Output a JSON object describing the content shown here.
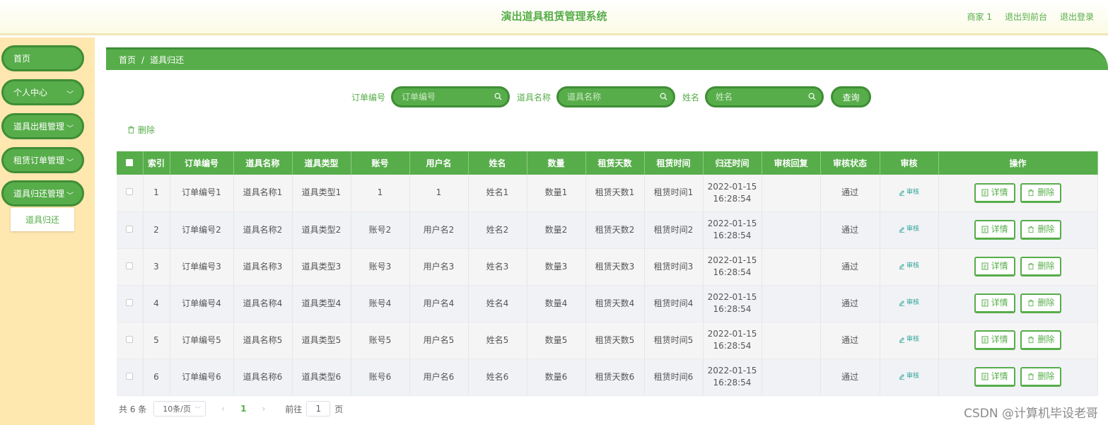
{
  "header": {
    "title": "演出道具租赁管理系统",
    "user": "商家 1",
    "front_link": "退出到前台",
    "logout_link": "退出登录"
  },
  "sidebar": {
    "items": [
      {
        "label": "首页",
        "has_children": false
      },
      {
        "label": "个人中心",
        "has_children": true
      },
      {
        "label": "道具出租管理",
        "has_children": true
      },
      {
        "label": "租赁订单管理",
        "has_children": true
      },
      {
        "label": "道具归还管理",
        "has_children": true
      }
    ],
    "active_sub": "道具归还"
  },
  "breadcrumb": {
    "home": "首页",
    "separator": "/",
    "current": "道具归还"
  },
  "search": {
    "order_label": "订单编号",
    "order_placeholder": "订单编号",
    "prop_label": "道具名称",
    "prop_placeholder": "道具名称",
    "name_label": "姓名",
    "name_placeholder": "姓名",
    "query_button": "查询"
  },
  "toolbar": {
    "delete_label": "删除"
  },
  "table": {
    "columns": [
      "索引",
      "订单编号",
      "道具名称",
      "道具类型",
      "账号",
      "用户名",
      "姓名",
      "数量",
      "租赁天数",
      "租赁时间",
      "归还时间",
      "审核回复",
      "审核状态",
      "审核",
      "操作"
    ],
    "review_label": "审核",
    "detail_label": "详情",
    "delete_label": "删除",
    "rows": [
      {
        "index": "1",
        "order_no": "订单编号1",
        "prop_name": "道具名称1",
        "prop_type": "道具类型1",
        "account": "1",
        "username": "1",
        "name": "姓名1",
        "quantity": "数量1",
        "days": "租赁天数1",
        "rent_time": "租赁时间1",
        "return_date": "2022-01-15",
        "return_clock": "16:28:54",
        "reply": "",
        "status": "通过"
      },
      {
        "index": "2",
        "order_no": "订单编号2",
        "prop_name": "道具名称2",
        "prop_type": "道具类型2",
        "account": "账号2",
        "username": "用户名2",
        "name": "姓名2",
        "quantity": "数量2",
        "days": "租赁天数2",
        "rent_time": "租赁时间2",
        "return_date": "2022-01-15",
        "return_clock": "16:28:54",
        "reply": "",
        "status": "通过"
      },
      {
        "index": "3",
        "order_no": "订单编号3",
        "prop_name": "道具名称3",
        "prop_type": "道具类型3",
        "account": "账号3",
        "username": "用户名3",
        "name": "姓名3",
        "quantity": "数量3",
        "days": "租赁天数3",
        "rent_time": "租赁时间3",
        "return_date": "2022-01-15",
        "return_clock": "16:28:54",
        "reply": "",
        "status": "通过"
      },
      {
        "index": "4",
        "order_no": "订单编号4",
        "prop_name": "道具名称4",
        "prop_type": "道具类型4",
        "account": "账号4",
        "username": "用户名4",
        "name": "姓名4",
        "quantity": "数量4",
        "days": "租赁天数4",
        "rent_time": "租赁时间4",
        "return_date": "2022-01-15",
        "return_clock": "16:28:54",
        "reply": "",
        "status": "通过"
      },
      {
        "index": "5",
        "order_no": "订单编号5",
        "prop_name": "道具名称5",
        "prop_type": "道具类型5",
        "account": "账号5",
        "username": "用户名5",
        "name": "姓名5",
        "quantity": "数量5",
        "days": "租赁天数5",
        "rent_time": "租赁时间5",
        "return_date": "2022-01-15",
        "return_clock": "16:28:54",
        "reply": "",
        "status": "通过"
      },
      {
        "index": "6",
        "order_no": "订单编号6",
        "prop_name": "道具名称6",
        "prop_type": "道具类型6",
        "account": "账号6",
        "username": "用户名6",
        "name": "姓名6",
        "quantity": "数量6",
        "days": "租赁天数6",
        "rent_time": "租赁时间6",
        "return_date": "2022-01-15",
        "return_clock": "16:28:54",
        "reply": "",
        "status": "通过"
      }
    ]
  },
  "pagination": {
    "total": "共 6 条",
    "page_size": "10条/页",
    "current_page": "1",
    "goto_label": "前往",
    "goto_value": "1",
    "page_unit": "页"
  },
  "watermark": "CSDN @计算机毕设老哥",
  "colors": {
    "primary": "#57ad4a",
    "primary_dark": "#3f8e35",
    "sidebar_bg": "#ffe7b0",
    "link_teal": "#2fa59a"
  }
}
